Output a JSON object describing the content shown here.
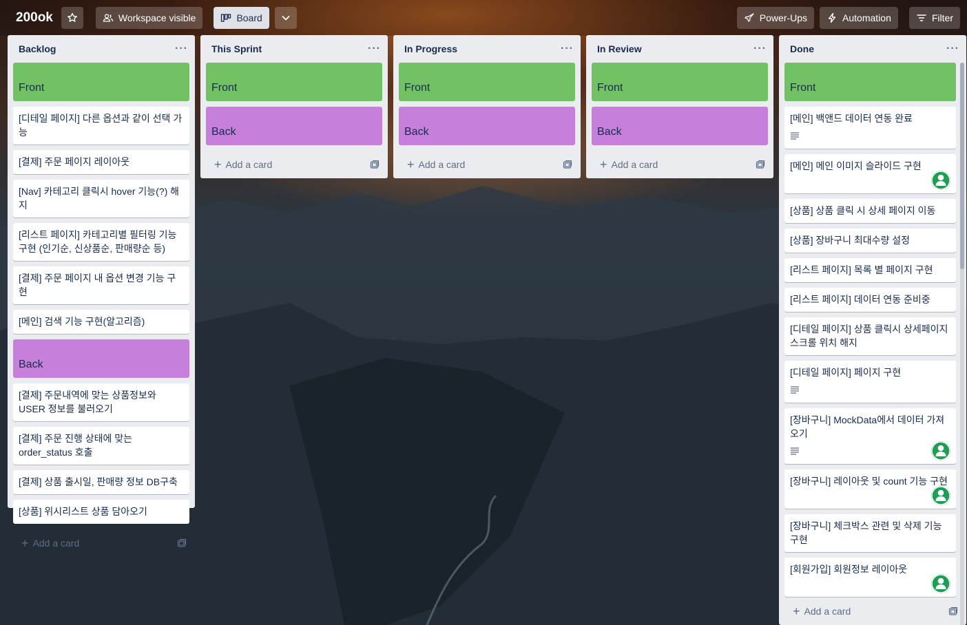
{
  "header": {
    "board_name": "200ok",
    "visibility_label": "Workspace visible",
    "view_label": "Board",
    "powerups_label": "Power-Ups",
    "automation_label": "Automation",
    "filter_label": "Filter"
  },
  "common": {
    "add_card": "Add a card",
    "menu": "···"
  },
  "lists": [
    {
      "title": "Backlog",
      "cards": [
        {
          "text": "Front",
          "type": "label",
          "color": "#72c164"
        },
        {
          "text": "[디테일 페이지] 다른 옵션과 같이 선택 가능"
        },
        {
          "text": "[결제] 주문 페이지 레이아웃"
        },
        {
          "text": "[Nav] 카테고리 클릭시 hover 기능(?) 해지"
        },
        {
          "text": "[리스트 페이지] 카테고리별 필터링 기능 구현 (인기순, 신상품순, 판매량순 등)"
        },
        {
          "text": "[결제] 주문 페이지 내 옵션 변경 기능 구현"
        },
        {
          "text": "[메인] 검색 기능 구현(알고리즘)"
        },
        {
          "text": "Back",
          "type": "label",
          "color": "#c67fdb"
        },
        {
          "text": "[결제] 주문내역에 맞는 상품정보와 USER 정보를 불러오기"
        },
        {
          "text": "[결제] 주문 진행 상태에 맞는 order_status 호출"
        },
        {
          "text": "[결제] 상품 출시일, 판매량 정보 DB구축"
        },
        {
          "text": "[상품] 위시리스트 상품 담아오기"
        }
      ]
    },
    {
      "title": "This Sprint",
      "cards": [
        {
          "text": "Front",
          "type": "label",
          "color": "#72c164"
        },
        {
          "text": "Back",
          "type": "label",
          "color": "#c67fdb"
        }
      ]
    },
    {
      "title": "In Progress",
      "cards": [
        {
          "text": "Front",
          "type": "label",
          "color": "#72c164"
        },
        {
          "text": "Back",
          "type": "label",
          "color": "#c67fdb"
        }
      ]
    },
    {
      "title": "In Review",
      "cards": [
        {
          "text": "Front",
          "type": "label",
          "color": "#72c164"
        },
        {
          "text": "Back",
          "type": "label",
          "color": "#c67fdb"
        }
      ]
    },
    {
      "title": "Done",
      "cards": [
        {
          "text": "Front",
          "type": "label",
          "color": "#72c164"
        },
        {
          "text": "[메인] 백앤드 데이터 연동 완료",
          "desc": true
        },
        {
          "text": "[메인] 메인 이미지 슬라이드 구현",
          "avatar": true
        },
        {
          "text": "[상품] 상품 클릭 시 상세 페이지 이동"
        },
        {
          "text": "[상품] 장바구니 최대수량 설정"
        },
        {
          "text": "[리스트 페이지] 목록 별 페이지 구현"
        },
        {
          "text": "[리스트 페이지] 데이터 연동 준비중"
        },
        {
          "text": "[디테일 페이지] 상품 클릭시 상세페이지 스크롤 위치 해지"
        },
        {
          "text": "[디테일 페이지] 페이지 구현",
          "desc": true
        },
        {
          "text": "[장바구니] MockData에서 데이터 가져오기",
          "desc": true,
          "avatar": true
        },
        {
          "text": "[장바구니] 레이아웃 및 count 기능 구현",
          "avatar": true
        },
        {
          "text": "[장바구니] 체크박스 관련 및 삭제 기능 구현"
        },
        {
          "text": "[회원가입] 회원정보 레이아웃",
          "avatar": true
        }
      ]
    }
  ]
}
